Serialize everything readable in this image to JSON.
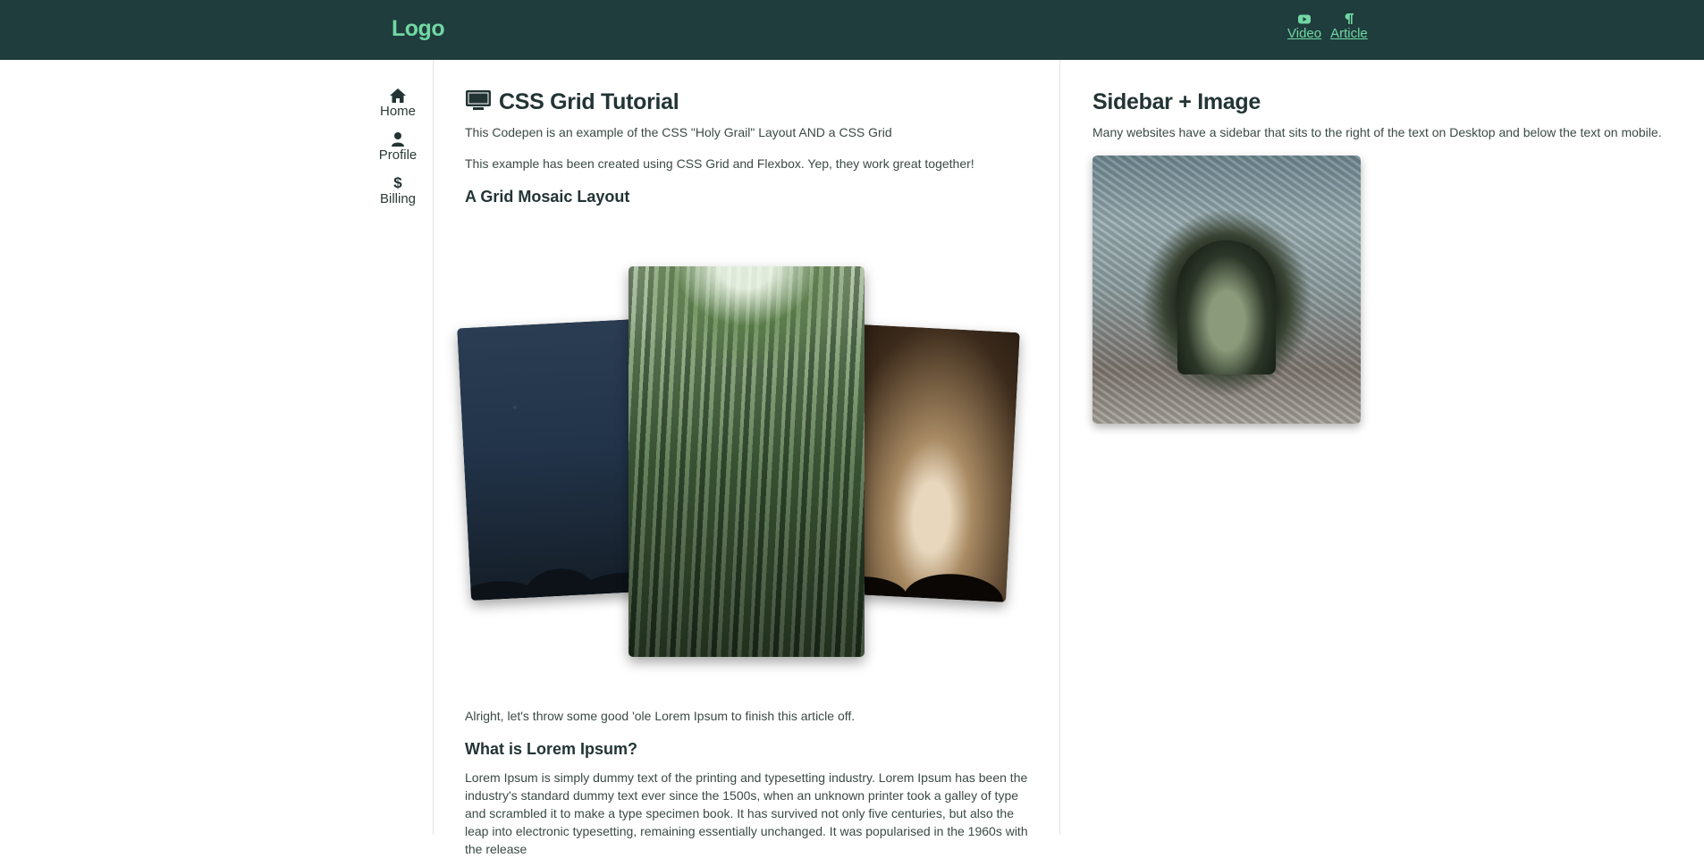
{
  "header": {
    "logo": "Logo",
    "nav": [
      {
        "label": "Video",
        "icon": "youtube-icon"
      },
      {
        "label": "Article",
        "icon": "paragraph-icon"
      }
    ]
  },
  "sidebar_nav": [
    {
      "label": "Home",
      "icon": "home-icon"
    },
    {
      "label": "Profile",
      "icon": "user-icon"
    },
    {
      "label": "Billing",
      "icon": "dollar-icon"
    }
  ],
  "main": {
    "title": "CSS Grid Tutorial",
    "intro1": "This Codepen is an example of the CSS \"Holy Grail\" Layout AND a CSS Grid",
    "intro2": "This example has been created using CSS Grid and Flexbox. Yep, they work great together!",
    "mosaic_heading": "A Grid Mosaic Layout",
    "outro": "Alright, let's throw some good 'ole Lorem Ipsum to finish this article off.",
    "lorem_heading": "What is Lorem Ipsum?",
    "lorem_text": "Lorem Ipsum is simply dummy text of the printing and typesetting industry. Lorem Ipsum has been the industry's standard dummy text ever since the 1500s, when an unknown printer took a galley of type and scrambled it to make a type specimen book. It has survived not only five centuries, but also the leap into electronic typesetting, remaining essentially unchanged. It was popularised in the 1960s with the release"
  },
  "aside": {
    "title": "Sidebar + Image",
    "text": "Many websites have a sidebar that sits to the right of the text on Desktop and below the text on mobile."
  },
  "colors": {
    "header_bg": "#1f3d3d",
    "accent": "#72d7a4",
    "text": "#2b3a36"
  }
}
